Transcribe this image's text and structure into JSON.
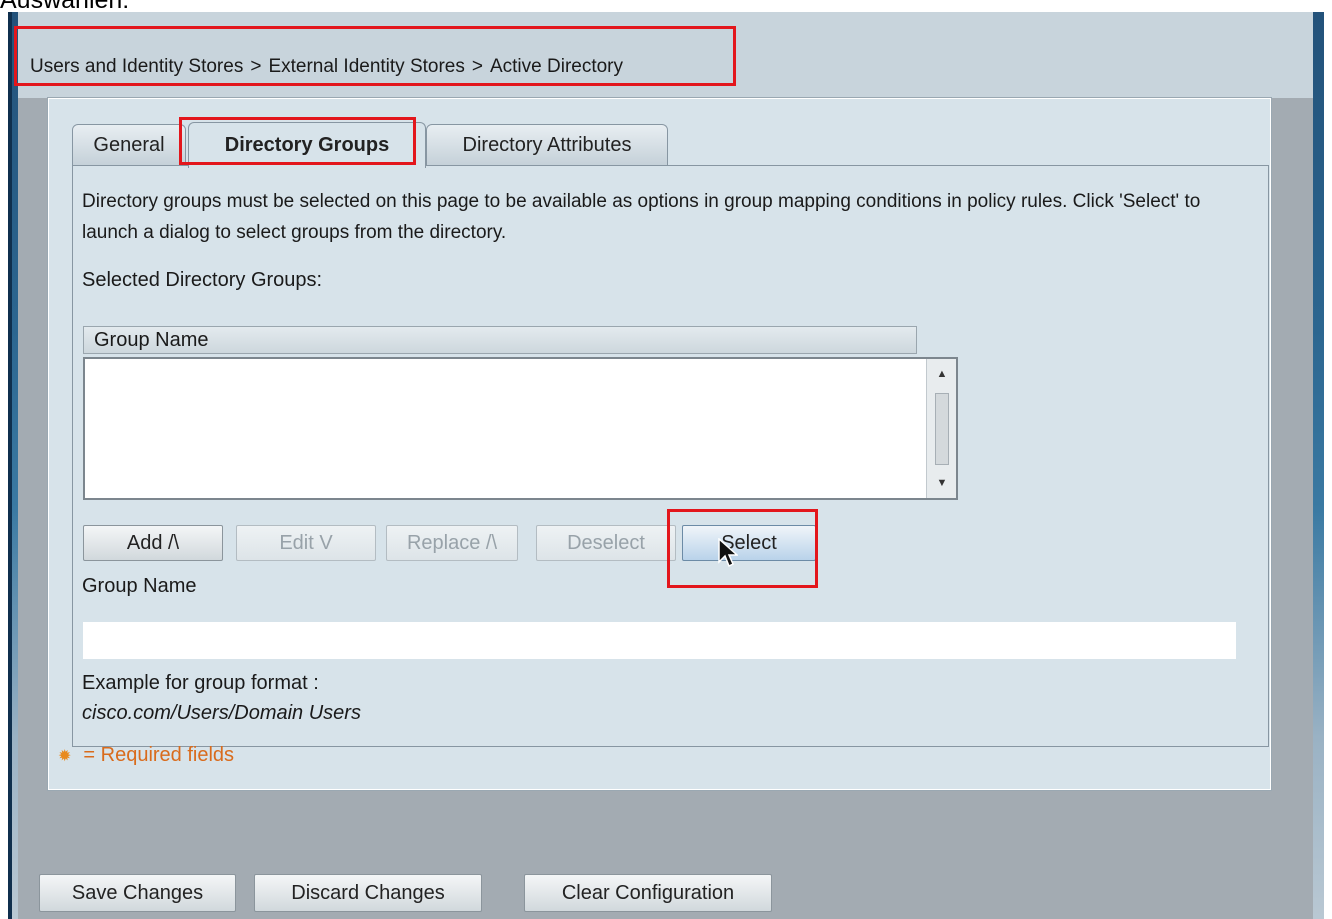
{
  "page_caption": "Auswählen:",
  "breadcrumb": {
    "items": [
      "Users and Identity Stores",
      "External Identity Stores",
      "Active Directory"
    ],
    "separator": ">"
  },
  "tabs": [
    {
      "label": "General",
      "active": false
    },
    {
      "label": "Directory Groups",
      "active": true
    },
    {
      "label": "Directory Attributes",
      "active": false
    }
  ],
  "description": "Directory groups must be selected on this page to be available as options in group mapping conditions in policy rules. Click 'Select' to launch a dialog to select groups from the directory.",
  "selected_groups": {
    "label": "Selected Directory Groups:",
    "column_header": "Group Name",
    "rows": []
  },
  "list_buttons": {
    "add": "Add /\\",
    "edit": "Edit V",
    "replace": "Replace /\\",
    "deselect": "Deselect",
    "select": "Select"
  },
  "group_name_field": {
    "label": "Group Name",
    "value": "",
    "placeholder": ""
  },
  "example": {
    "label": "Example for group format :",
    "value": "cisco.com/Users/Domain Users"
  },
  "required_note": "= Required fields",
  "footer_buttons": {
    "save": "Save Changes",
    "discard": "Discard Changes",
    "clear": "Clear Configuration"
  },
  "colors": {
    "highlight": "#e3161c",
    "required": "#d96b1c",
    "panel_background": "#d7e3ea"
  },
  "icons": {
    "required": "gear-icon",
    "cursor": "mouse-pointer-icon"
  }
}
